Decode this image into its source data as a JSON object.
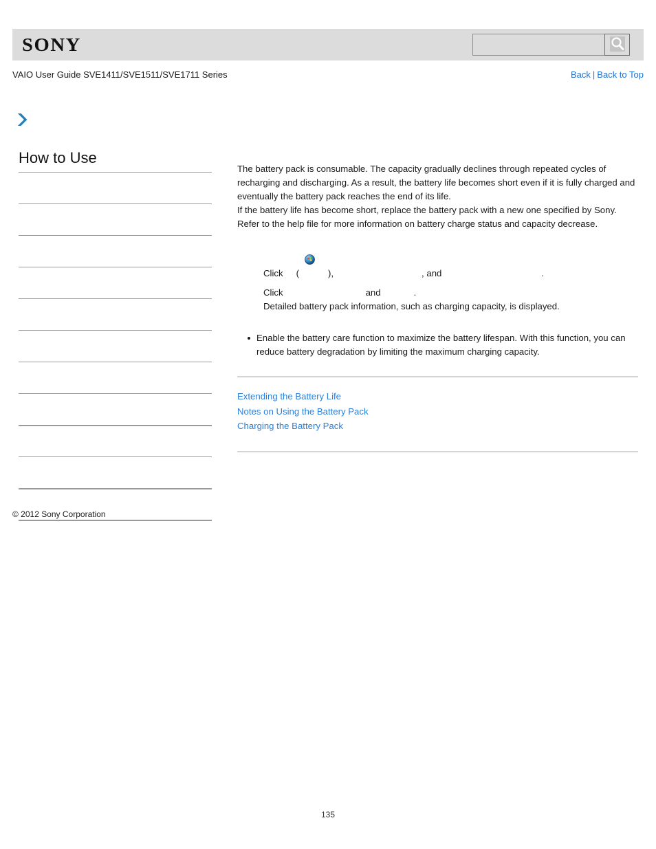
{
  "header": {
    "logo_text": "SONY",
    "search": {
      "value": "",
      "placeholder": "",
      "button_icon": "search-icon"
    }
  },
  "subtitle": {
    "guide_title": "VAIO User Guide SVE1411/SVE1511/SVE1711 Series",
    "back_label": "Back",
    "separator": "|",
    "back_to_top_label": "Back to Top"
  },
  "sidebar": {
    "chevron_icon": "chevron-right-icon",
    "heading": "How to Use",
    "items": [
      {
        "label": ""
      },
      {
        "label": ""
      },
      {
        "label": ""
      },
      {
        "label": ""
      },
      {
        "label": ""
      },
      {
        "label": ""
      },
      {
        "label": ""
      },
      {
        "label": ""
      },
      {
        "label": ""
      },
      {
        "label": ""
      },
      {
        "label": ""
      }
    ],
    "copyright": "© 2012 Sony Corporation"
  },
  "main": {
    "paragraphs": [
      "The battery pack is consumable. The capacity gradually declines through repeated cycles of recharging and discharging. As a result, the battery life becomes short even if it is fully charged and eventually the battery pack reaches the end of its life.",
      "If the battery life has become short, replace the battery pack with a new one specified by Sony. Refer to the help file for more information on battery charge status and capacity decrease."
    ],
    "steps": {
      "step1_click": "Click",
      "step1_open_paren": "(",
      "step1_close_paren": "),",
      "step1_comma_and": ", and",
      "step1_period": ".",
      "step1_icon": "windows-start-orb-icon",
      "step2_click": "Click",
      "step2_and": "and",
      "step2_period": ".",
      "step_result": "Detailed battery pack information, such as charging capacity, is displayed."
    },
    "notes": [
      "Enable the battery care function to maximize the battery lifespan. With this function, you can reduce battery degradation by limiting the maximum charging capacity."
    ],
    "related_links": [
      "Extending the Battery Life",
      "Notes on Using the Battery Pack",
      "Charging the Battery Pack"
    ]
  },
  "footer": {
    "page_number": "135"
  },
  "colors": {
    "link_blue": "#1b72d0",
    "related_link_blue": "#2a7fdc",
    "header_band": "#dcdcdc",
    "rule_gray": "#d4d4d4",
    "sidebar_rule": "#9a9a9a"
  }
}
